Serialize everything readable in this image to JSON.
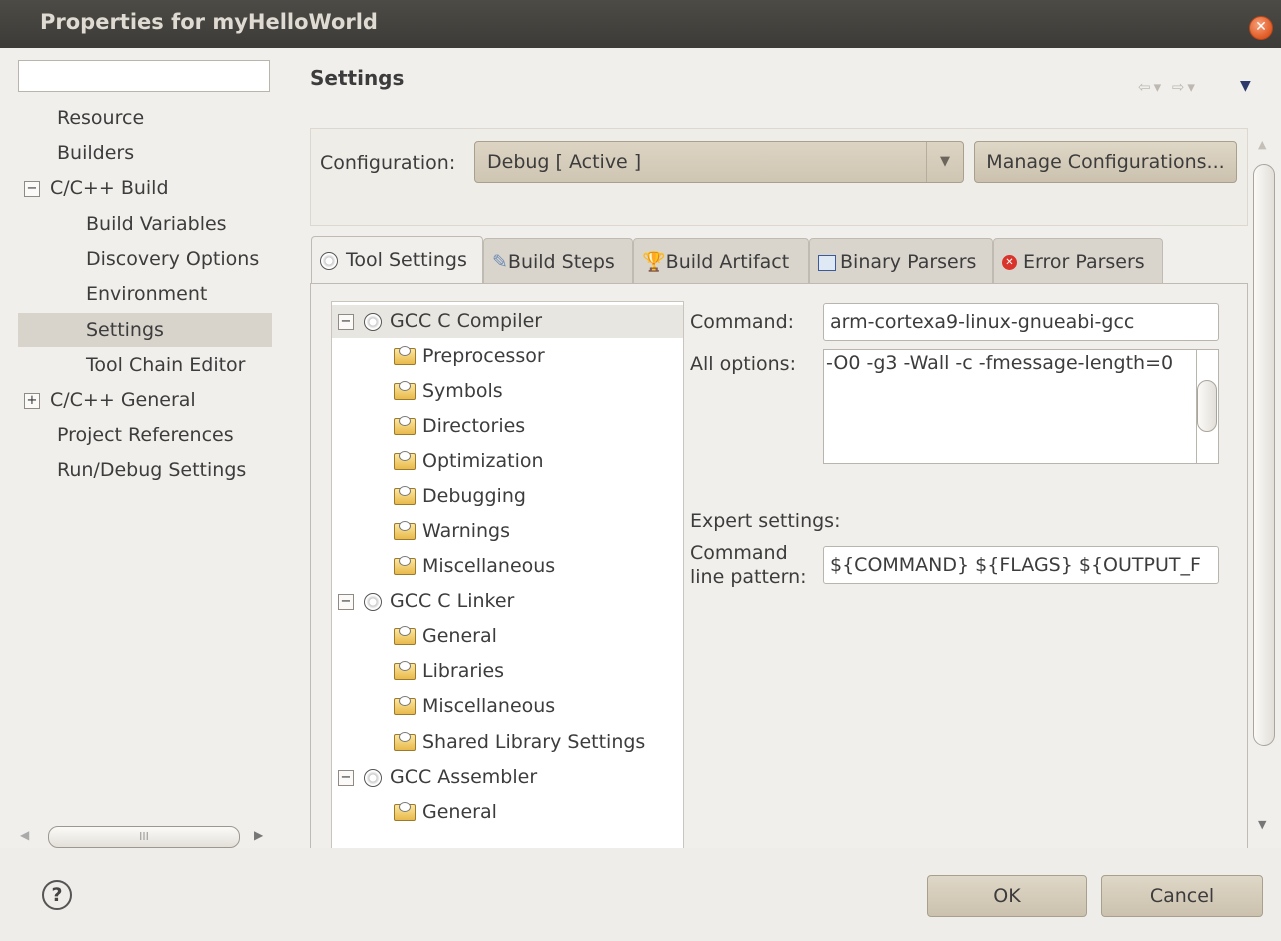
{
  "window": {
    "title": "Properties for myHelloWorld"
  },
  "filter": {
    "value": ""
  },
  "nav": {
    "items": [
      {
        "label": "Resource"
      },
      {
        "label": "Builders"
      },
      {
        "label": "C/C++ Build",
        "toggle": "−"
      },
      {
        "label": "Build Variables"
      },
      {
        "label": "Discovery Options"
      },
      {
        "label": "Environment"
      },
      {
        "label": "Settings"
      },
      {
        "label": "Tool Chain Editor"
      },
      {
        "label": "C/C++ General",
        "toggle": "+"
      },
      {
        "label": "Project References"
      },
      {
        "label": "Run/Debug Settings"
      }
    ],
    "scroll_grip": "III"
  },
  "page": {
    "title": "Settings",
    "nav_arrows": "⇦▾ ⇨▾",
    "menu_arrow": "▼"
  },
  "config": {
    "label": "Configuration:",
    "value": "Debug  [ Active ]",
    "manage_label": "Manage Configurations..."
  },
  "tabs": [
    {
      "label": "Tool Settings"
    },
    {
      "label": "Build Steps"
    },
    {
      "label": "Build Artifact"
    },
    {
      "label": "Binary Parsers"
    },
    {
      "label": "Error Parsers"
    }
  ],
  "tool_tree": [
    {
      "label": "GCC C Compiler",
      "toggle": "−"
    },
    {
      "label": "Preprocessor"
    },
    {
      "label": "Symbols"
    },
    {
      "label": "Directories"
    },
    {
      "label": "Optimization"
    },
    {
      "label": "Debugging"
    },
    {
      "label": "Warnings"
    },
    {
      "label": "Miscellaneous"
    },
    {
      "label": "GCC C Linker",
      "toggle": "−"
    },
    {
      "label": "General"
    },
    {
      "label": "Libraries"
    },
    {
      "label": "Miscellaneous"
    },
    {
      "label": "Shared Library Settings"
    },
    {
      "label": "GCC Assembler",
      "toggle": "−"
    },
    {
      "label": "General"
    }
  ],
  "tool_form": {
    "command_label": "Command:",
    "command_value": "arm-cortexa9-linux-gnueabi-gcc",
    "all_options_label": "All options:",
    "all_options_value": "-O0 -g3 -Wall -c -fmessage-length=0",
    "expert_label": "Expert settings:",
    "pattern_label_1": "Command",
    "pattern_label_2": "line pattern:",
    "pattern_value": "${COMMAND} ${FLAGS} ${OUTPUT_F"
  },
  "footer": {
    "help_symbol": "?",
    "ok_label": "OK",
    "cancel_label": "Cancel"
  }
}
